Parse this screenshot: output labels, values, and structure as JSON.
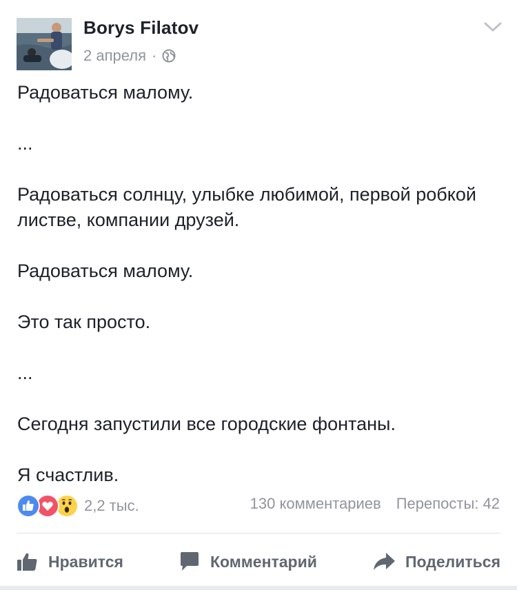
{
  "header": {
    "author": "Borys Filatov",
    "date": "2 апреля",
    "separator": "·",
    "privacy_icon": "globe-icon",
    "menu_icon": "chevron-down-icon"
  },
  "body": {
    "paragraphs": [
      "Радоваться малому.",
      "...",
      "Радоваться солнцу, улыбке любимой, первой робкой листве, компании друзей.",
      "Радоваться малому.",
      "Это так просто.",
      "...",
      "Сегодня запустили все городские фонтаны.",
      "Я счастлив."
    ]
  },
  "stats": {
    "reaction_icons": [
      "like-icon",
      "love-icon",
      "wow-icon"
    ],
    "reactions_count": "2,2 тыс.",
    "comments": "130 комментариев",
    "shares": "Перепосты: 42"
  },
  "actions": {
    "like_label": "Нравится",
    "comment_label": "Комментарий",
    "share_label": "Поделиться"
  },
  "colors": {
    "like_blue": "#4d8af0",
    "love_red": "#f25268",
    "wow_yellow": "#fcd34a",
    "secondary_text": "#90949c"
  }
}
